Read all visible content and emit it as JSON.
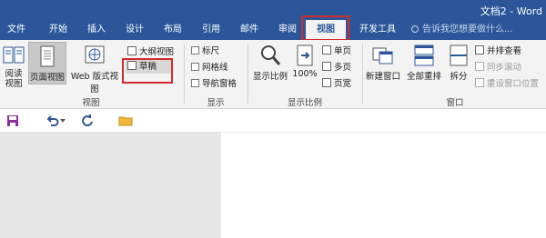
{
  "window": {
    "title": "文档2 - Word"
  },
  "tabs": [
    {
      "label": "文件"
    },
    {
      "label": "开始"
    },
    {
      "label": "插入"
    },
    {
      "label": "设计"
    },
    {
      "label": "布局"
    },
    {
      "label": "引用"
    },
    {
      "label": "邮件"
    },
    {
      "label": "审阅"
    },
    {
      "label": "视图",
      "active": true
    },
    {
      "label": "开发工具"
    }
  ],
  "tell_me": {
    "placeholder": "告诉我您想要做什么..."
  },
  "ribbon": {
    "views": {
      "label": "视图",
      "read_mode": "阅读\n视图",
      "print_layout": "页面视图",
      "web_layout": "Web 版式视图",
      "outline": "大纲视图",
      "draft": "草稿"
    },
    "show": {
      "label": "显示",
      "ruler": "标尺",
      "gridlines": "网格线",
      "nav_pane": "导航窗格"
    },
    "zoom": {
      "label": "显示比例",
      "zoom": "显示比例",
      "hundred": "100%",
      "one_page": "单页",
      "multi_page": "多页",
      "page_width": "页宽"
    },
    "window": {
      "label": "窗口",
      "new_window": "新建窗口",
      "arrange_all": "全部重排",
      "split": "拆分",
      "side_by_side": "并排查看",
      "sync_scroll": "同步滚动",
      "reset_pos": "重设窗口位置"
    }
  },
  "colors": {
    "accent": "#2b579a",
    "highlight": "#d42a2a"
  }
}
